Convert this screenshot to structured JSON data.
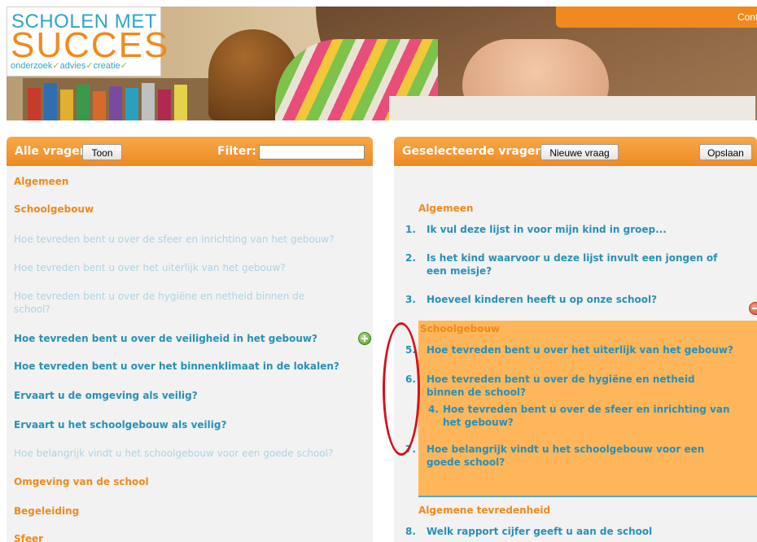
{
  "header": {
    "logo_top": "SCHOLEN MET",
    "logo_mid": "SUCCES",
    "logo_sub_1": "onderzoek",
    "logo_sub_2": "advies",
    "logo_sub_3": "creatie",
    "check": "✓",
    "contact_label": "Conta"
  },
  "left_panel": {
    "title": "Alle vragen",
    "show_button": "Toon",
    "filter_label": "Filter:",
    "filter_value": "",
    "items": [
      {
        "text": "Algemeen",
        "kind": "category"
      },
      {
        "text": "Schoolgebouw",
        "kind": "category"
      },
      {
        "text": "Hoe tevreden bent u over de sfeer en inrichting van het gebouw?",
        "kind": "used"
      },
      {
        "text": "Hoe tevreden bent u over het uiterlijk van het gebouw?",
        "kind": "used"
      },
      {
        "text": "Hoe tevreden bent u over de hygiëne en netheid binnen de school?",
        "kind": "used"
      },
      {
        "text": "Hoe tevreden bent u over de veiligheid in het gebouw?",
        "kind": "question"
      },
      {
        "text": "Hoe tevreden bent u over het binnenklimaat in de lokalen?",
        "kind": "question"
      },
      {
        "text": "Ervaart u de omgeving als veilig?",
        "kind": "question"
      },
      {
        "text": "Ervaart u het schoolgebouw als veilig?",
        "kind": "question"
      },
      {
        "text": "Hoe belangrijk vindt u het schoolgebouw voor een goede school?",
        "kind": "used"
      },
      {
        "text": "Omgeving van de school",
        "kind": "category"
      },
      {
        "text": "Begeleiding",
        "kind": "category"
      },
      {
        "text": "Sfeer",
        "kind": "category"
      }
    ]
  },
  "right_panel": {
    "title": "Geselecteerde vragen",
    "new_question_button": "Nieuwe vraag",
    "save_button": "Opslaan",
    "categories": [
      "Algemeen",
      "Schoolgebouw",
      "Algemene tevredenheid"
    ],
    "questions": [
      {
        "num": "1.",
        "text": "Ik vul deze lijst in voor mijn kind in groep..."
      },
      {
        "num": "2.",
        "text": "Is het kind waarvoor u deze lijst invult een jongen of een meisje?"
      },
      {
        "num": "3.",
        "text": "Hoeveel kinderen heeft u op onze school?"
      },
      {
        "num": "5.",
        "text": "Hoe tevreden bent u over het uiterlijk van het gebouw?"
      },
      {
        "num": "6.",
        "text": "Hoe tevreden bent u over de hygiëne en netheid binnen de school?"
      },
      {
        "num": "4.",
        "text": "Hoe tevreden bent u over de sfeer en inrichting van het gebouw?"
      },
      {
        "num": "7.",
        "text": "Hoe belangrijk vindt u het schoolgebouw voor een goede school?"
      },
      {
        "num": "8.",
        "text": "Welk rapport cijfer geeft u aan de school"
      }
    ]
  },
  "colors": {
    "accent": "#f08a1e",
    "question": "#2790b8",
    "question_used": "#aed3e3",
    "highlight": "#ffb65a",
    "annotation": "#d6101a"
  }
}
